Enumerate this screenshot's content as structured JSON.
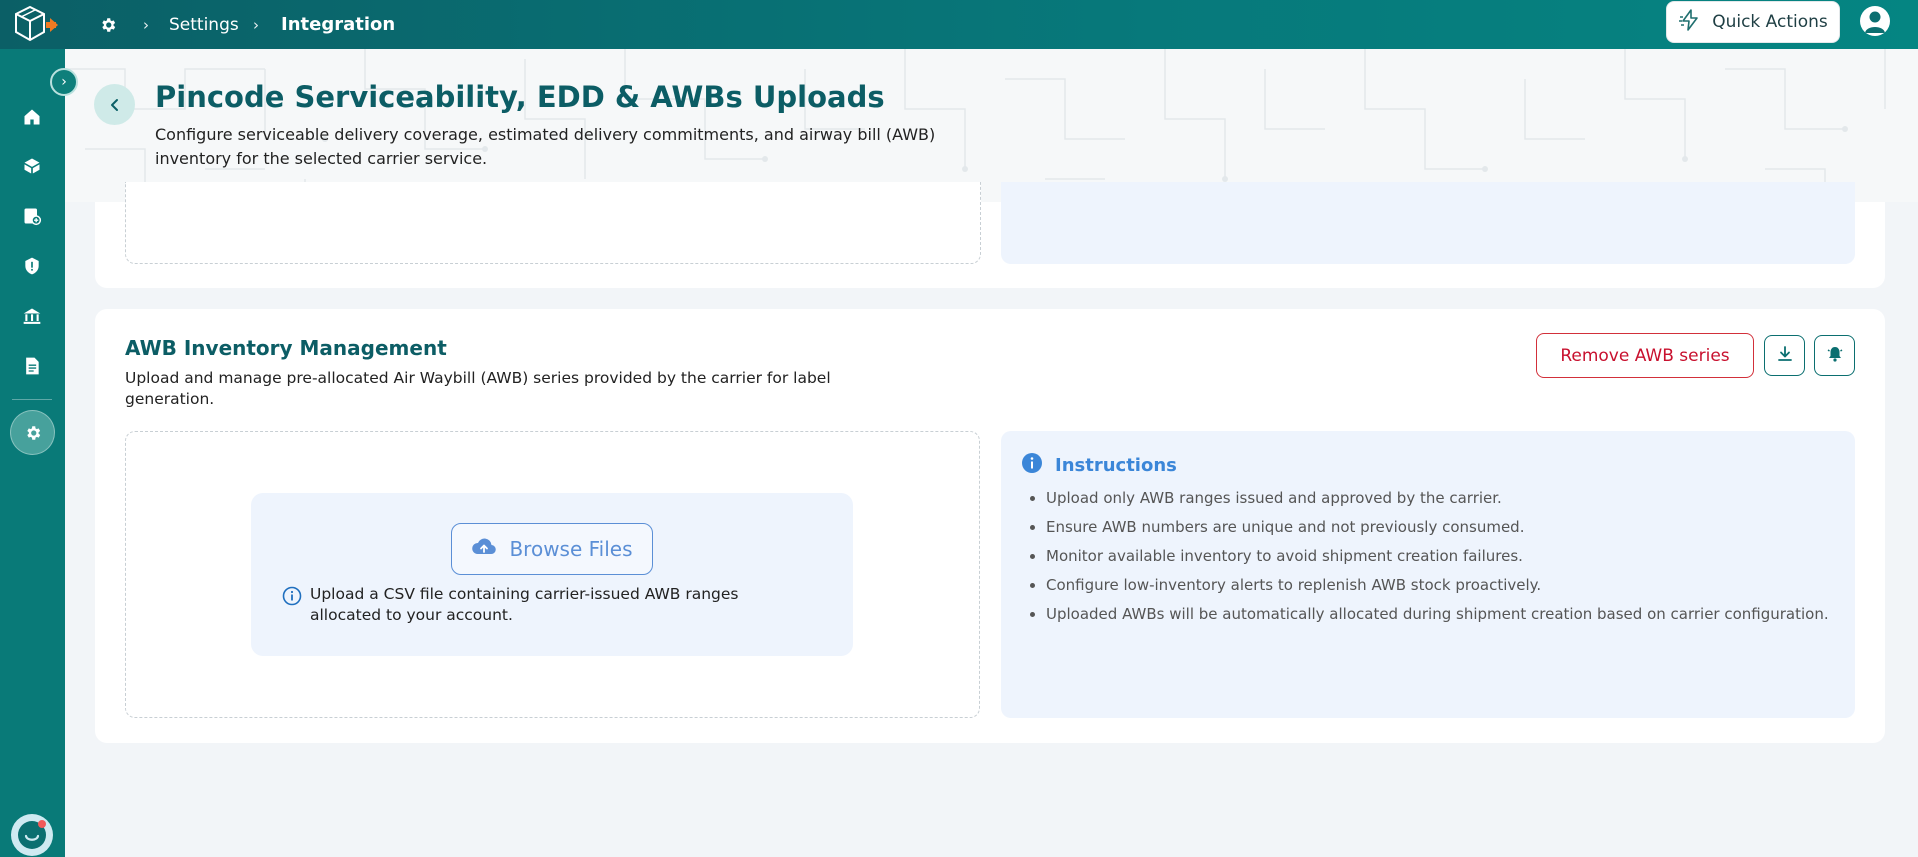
{
  "breadcrumb": {
    "settings": "Settings",
    "integration": "Integration"
  },
  "topbar": {
    "quick_actions": "Quick Actions"
  },
  "header": {
    "title": "Pincode Serviceability, EDD & AWBs Uploads",
    "description": "Configure serviceable delivery coverage, estimated delivery commitments, and airway bill (AWB) inventory for the selected carrier service."
  },
  "awb_section": {
    "title": "AWB Inventory Management",
    "description": "Upload and manage pre-allocated Air Waybill (AWB) series provided by the carrier for label generation.",
    "remove_button": "Remove AWB series",
    "browse_button": "Browse Files",
    "upload_note": "Upload a CSV file containing carrier-issued AWB ranges allocated to your account."
  },
  "instructions": {
    "title": "Instructions",
    "items": [
      "Upload only AWB ranges issued and approved by the carrier.",
      "Ensure AWB numbers are unique and not previously consumed.",
      "Monitor available inventory to avoid shipment creation failures.",
      "Configure low-inventory alerts to replenish AWB stock proactively.",
      "Uploaded AWBs will be automatically allocated during shipment creation based on carrier configuration."
    ]
  },
  "colors": {
    "primary": "#0b6f70",
    "title": "#0c5d65",
    "danger": "#c8102e",
    "info": "#3b86d8"
  }
}
